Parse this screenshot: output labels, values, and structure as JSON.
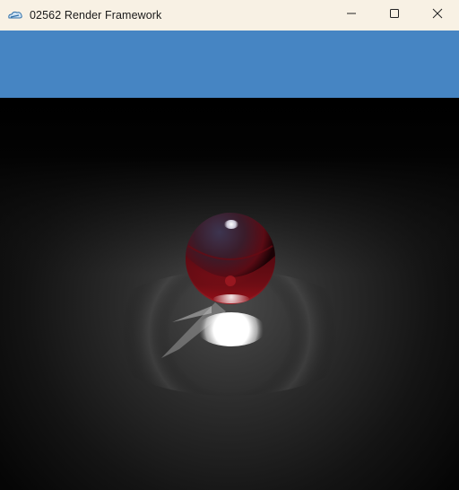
{
  "window": {
    "title": "02562 Render Framework",
    "icon": "app-cloud-icon",
    "controls": [
      "minimize-icon",
      "maximize-icon",
      "close-icon"
    ]
  },
  "header_bar": {
    "color": "#4685c3"
  },
  "scene": {
    "background": "#000000",
    "floor_color": "#3a3a3a",
    "sphere_color": "#7a0e12",
    "highlight_color": "#ffffff"
  }
}
